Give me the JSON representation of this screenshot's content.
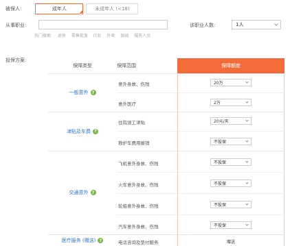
{
  "insured": {
    "label": "被保人:",
    "options": [
      {
        "label": "成年人",
        "active": true
      },
      {
        "label": "未成年人 (<18)",
        "active": false
      }
    ]
  },
  "occupation": {
    "label": "从事职业:",
    "value": "",
    "hot_label": "热门搜索:",
    "hot_items": [
      "退休",
      "零售批发",
      "IT业",
      "外卖",
      "保姆",
      "服务人员"
    ]
  },
  "employee_count": {
    "label": "该职业人数:",
    "value": "1人"
  },
  "plan": {
    "label": "投保方案:",
    "headers": {
      "type": "保障类型",
      "scope": "保障范围",
      "amount": "保障额度"
    },
    "categories": [
      {
        "name": "一般意外",
        "help": "?"
      },
      {
        "name": "津贴及车费",
        "help": "?"
      },
      {
        "name": "交通意外",
        "help": "?"
      },
      {
        "name": "医疗服务 (赠送)",
        "help": "?"
      }
    ],
    "items": [
      {
        "scope": "意外身故、伤残",
        "amount": "20万"
      },
      {
        "scope": "意外医疗",
        "amount": "2万"
      },
      {
        "scope": "住院误工津贴",
        "amount": "20元/天"
      },
      {
        "scope": "救护车费用报销",
        "amount": "不投保"
      },
      {
        "scope": "飞机意外身故、伤残",
        "amount": "不投保"
      },
      {
        "scope": "火车意外身故、伤残",
        "amount": "不投保"
      },
      {
        "scope": "轮船意外身故、伤残",
        "amount": "不投保"
      },
      {
        "scope": "汽车意外身故、伤残",
        "amount": "不投保"
      },
      {
        "scope": "电话咨询及垫付服务",
        "amount": "赠送"
      }
    ]
  },
  "colors": {
    "accent": "#f26c3a",
    "link": "#2b74c7",
    "help_badge": "#7ab648"
  }
}
